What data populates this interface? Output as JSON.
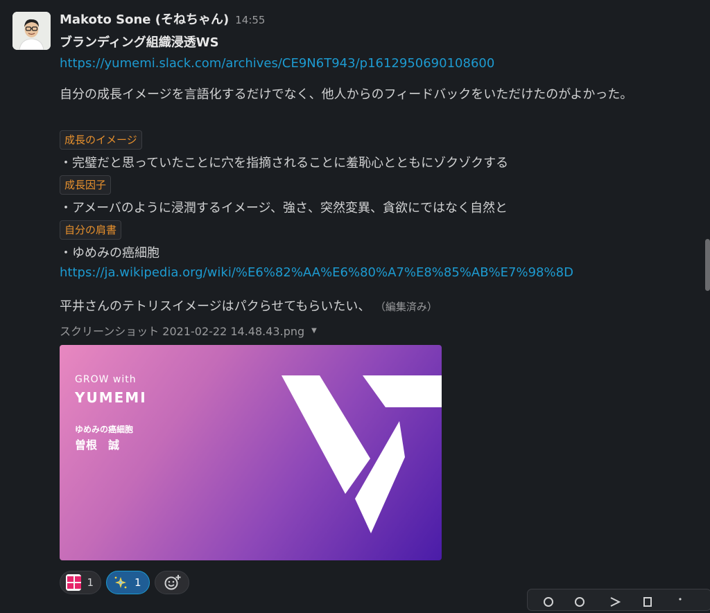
{
  "message": {
    "author": "Makoto Sone (そねちゃん)",
    "time": "14:55",
    "title": "ブランディング組織浸透WS",
    "link1": "https://yumemi.slack.com/archives/CE9N6T943/p1612950690108600",
    "paragraph": "自分の成長イメージを言語化するだけでなく、他人からのフィードバックをいただけたのがよかった。",
    "sections": [
      {
        "tag": "成長のイメージ",
        "text": "・完璧だと思っていたことに穴を指摘されることに羞恥心とともにゾクゾクする"
      },
      {
        "tag": "成長因子",
        "text": "・アメーバのように浸潤するイメージ、強さ、突然変異、貪欲にではなく自然と"
      },
      {
        "tag": "自分の肩書",
        "text": "・ゆめみの癌細胞"
      }
    ],
    "link2": "https://ja.wikipedia.org/wiki/%E6%82%AA%E6%80%A7%E8%85%AB%E7%98%8D",
    "closing": "平井さんのテトリスイメージはパクらせてもらいたい、",
    "edited": "（編集済み）"
  },
  "attachment": {
    "filename": "スクリーンショット 2021-02-22 14.48.43.png",
    "image_text": {
      "grow": "GROW with",
      "brand": "YUMEMI",
      "role": "ゆめみの癌細胞",
      "name": "曽根　誠"
    }
  },
  "reactions": [
    {
      "emoji": "超イイネ",
      "count": "1"
    },
    {
      "emoji": "sparkle",
      "count": "1"
    }
  ],
  "icons": {
    "add_reaction": "add-reaction-icon",
    "dropdown": "chevron-down-icon"
  },
  "colors": {
    "background": "#1a1d21",
    "link": "#1d9bd1",
    "tag_text": "#e8912d",
    "reaction_active": "#1f5d95"
  }
}
